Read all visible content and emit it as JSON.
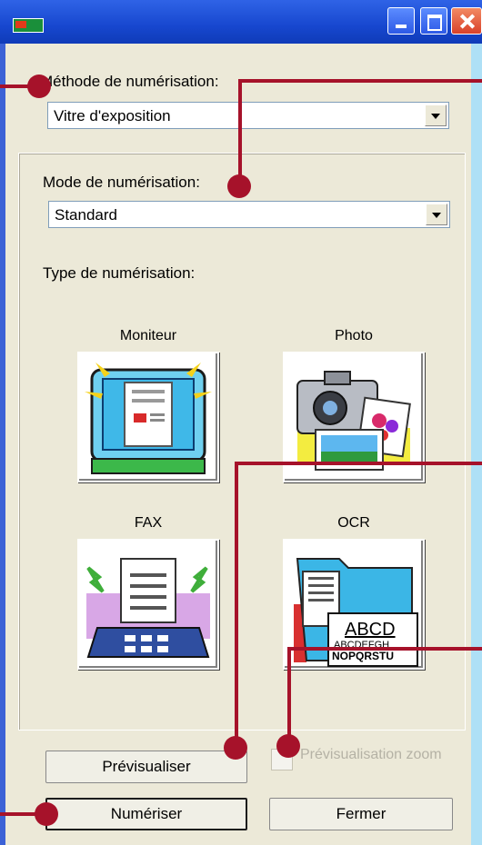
{
  "window": {
    "title": ""
  },
  "scan_method": {
    "label": "Méthode de numérisation:",
    "value": "Vitre d'exposition"
  },
  "scan_mode": {
    "label": "Mode de numérisation:",
    "value": "Standard"
  },
  "scan_type": {
    "label": "Type de numérisation:",
    "options": [
      {
        "label": "Moniteur"
      },
      {
        "label": "Photo"
      },
      {
        "label": "FAX"
      },
      {
        "label": "OCR"
      }
    ],
    "ocr_sample_text": [
      "ABCD",
      "ABCDEFGH",
      "NOPQRSTU"
    ]
  },
  "buttons": {
    "preview": "Prévisualiser",
    "scan": "Numériser",
    "close": "Fermer"
  },
  "zoom_preview": {
    "label": "Prévisualisation zoom",
    "checked": false,
    "enabled": false
  },
  "colors": {
    "title_bar": "#1747cf",
    "background": "#aee0f6",
    "callout": "#a6122a"
  }
}
